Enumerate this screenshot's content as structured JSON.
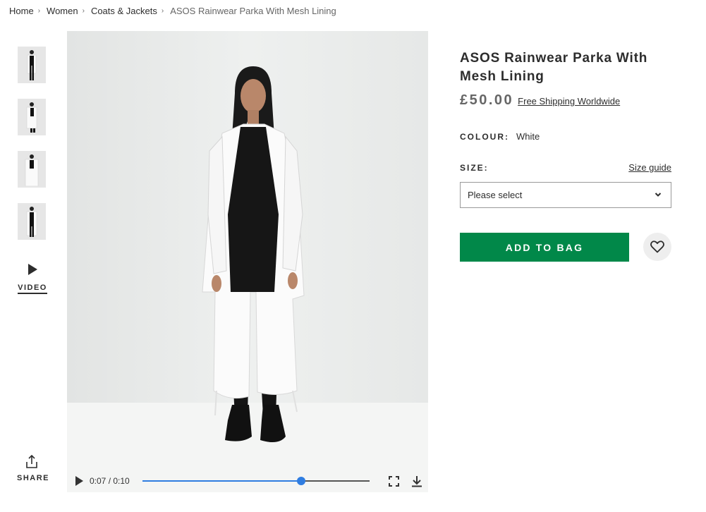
{
  "breadcrumb": {
    "items": [
      "Home",
      "Women",
      "Coats & Jackets"
    ],
    "current": "ASOS Rainwear Parka With Mesh Lining",
    "separator": "›"
  },
  "gallery": {
    "thumbnails": [
      {
        "alt": "parka-front-view"
      },
      {
        "alt": "parka-side-view"
      },
      {
        "alt": "parka-detail-view"
      },
      {
        "alt": "parka-back-view"
      }
    ],
    "video_label": "VIDEO",
    "share_label": "SHARE"
  },
  "player": {
    "time": "0:07 / 0:10",
    "progress_fraction": 0.7,
    "icons": [
      "play-icon",
      "fullscreen-icon",
      "download-icon"
    ]
  },
  "product": {
    "title": "ASOS Rainwear Parka With Mesh Lining",
    "price": "£50.00",
    "shipping": "Free Shipping Worldwide",
    "colour_label": "COLOUR:",
    "colour_value": "White",
    "size_label": "SIZE:",
    "size_guide": "Size guide",
    "size_placeholder": "Please select",
    "add_to_bag": "ADD TO BAG",
    "save_icon": "heart-icon"
  },
  "colors": {
    "accent_green": "#018849",
    "progress_blue": "#2f7de1",
    "text": "#2d2d2d"
  }
}
